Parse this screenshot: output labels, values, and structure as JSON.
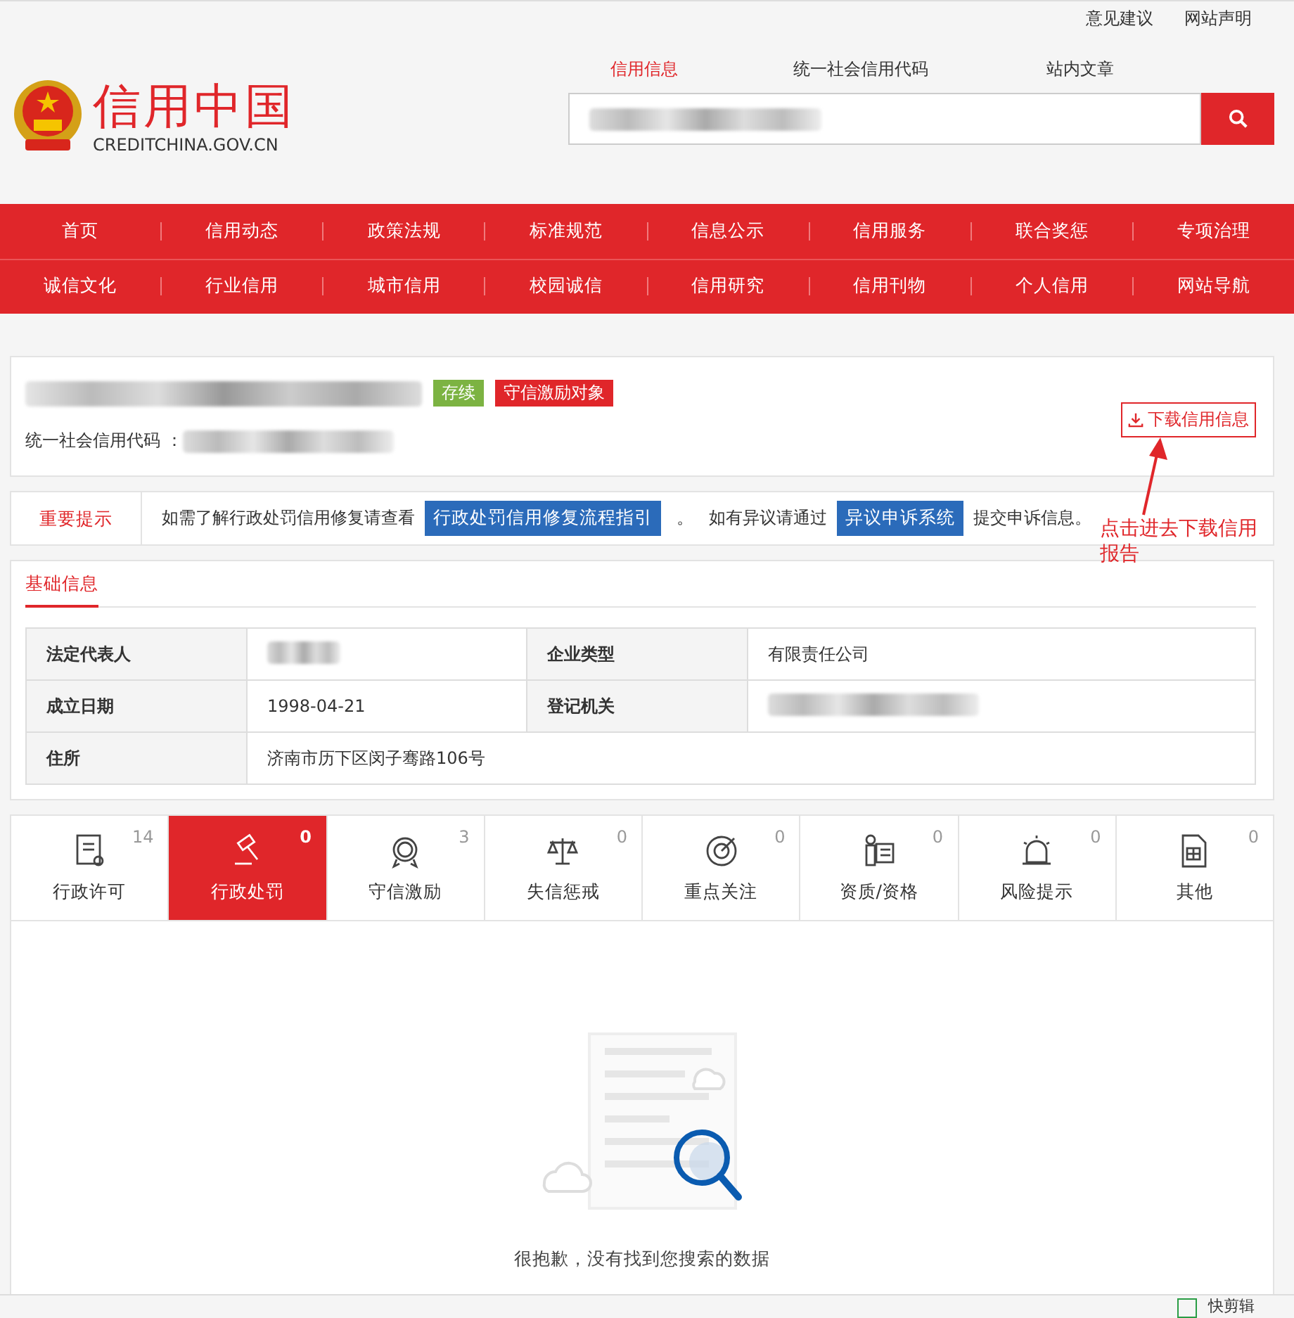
{
  "top_links": [
    "意见建议",
    "网站声明"
  ],
  "logo": {
    "title": "信用中国",
    "subtitle": "CREDITCHINA.GOV.CN"
  },
  "search": {
    "tabs": [
      {
        "label": "信用信息",
        "selected": true
      },
      {
        "label": "统一社会信用代码",
        "selected": false
      },
      {
        "label": "站内文章",
        "selected": false
      }
    ]
  },
  "nav": [
    [
      "首页",
      "信用动态",
      "政策法规",
      "标准规范",
      "信息公示",
      "信用服务",
      "联合奖惩",
      "专项治理"
    ],
    [
      "诚信文化",
      "行业信用",
      "城市信用",
      "校园诚信",
      "信用研究",
      "信用刊物",
      "个人信用",
      "网站导航"
    ]
  ],
  "company": {
    "tags": [
      {
        "label": "存续",
        "color": "#7cb342"
      },
      {
        "label": "守信激励对象",
        "color": "#e0262a"
      }
    ],
    "credit_code_label": "统一社会信用代码 ：",
    "download_button": "下载信用信息"
  },
  "notice": {
    "title": "重要提示",
    "text_1": "如需了解行政处罚信用修复请查看",
    "link_1": "行政处罚信用修复流程指引",
    "text_2": "。",
    "text_3": "如有异议请通过",
    "link_2": "异议申诉系统",
    "text_4": "提交申诉信息。"
  },
  "annotation": {
    "text": "点击进去下载信用报告"
  },
  "basic_info": {
    "tab": "基础信息",
    "rows": [
      [
        {
          "label": "法定代表人"
        },
        {
          "label": "企业类型",
          "value": "有限责任公司"
        }
      ],
      [
        {
          "label": "成立日期",
          "value": "1998-04-21"
        },
        {
          "label": "登记机关"
        }
      ],
      [
        {
          "label": "住所",
          "value": "济南市历下区闵子骞路106号"
        }
      ]
    ]
  },
  "categories": [
    {
      "label": "行政许可",
      "count": "14",
      "selected": false
    },
    {
      "label": "行政处罚",
      "count": "0",
      "selected": true
    },
    {
      "label": "守信激励",
      "count": "3",
      "selected": false
    },
    {
      "label": "失信惩戒",
      "count": "0",
      "selected": false
    },
    {
      "label": "重点关注",
      "count": "0",
      "selected": false
    },
    {
      "label": "资质/资格",
      "count": "0",
      "selected": false
    },
    {
      "label": "风险提示",
      "count": "0",
      "selected": false
    },
    {
      "label": "其他",
      "count": "0",
      "selected": false
    }
  ],
  "empty_message": "很抱歉，没有找到您搜索的数据",
  "footer": {
    "tool": "快剪辑"
  }
}
